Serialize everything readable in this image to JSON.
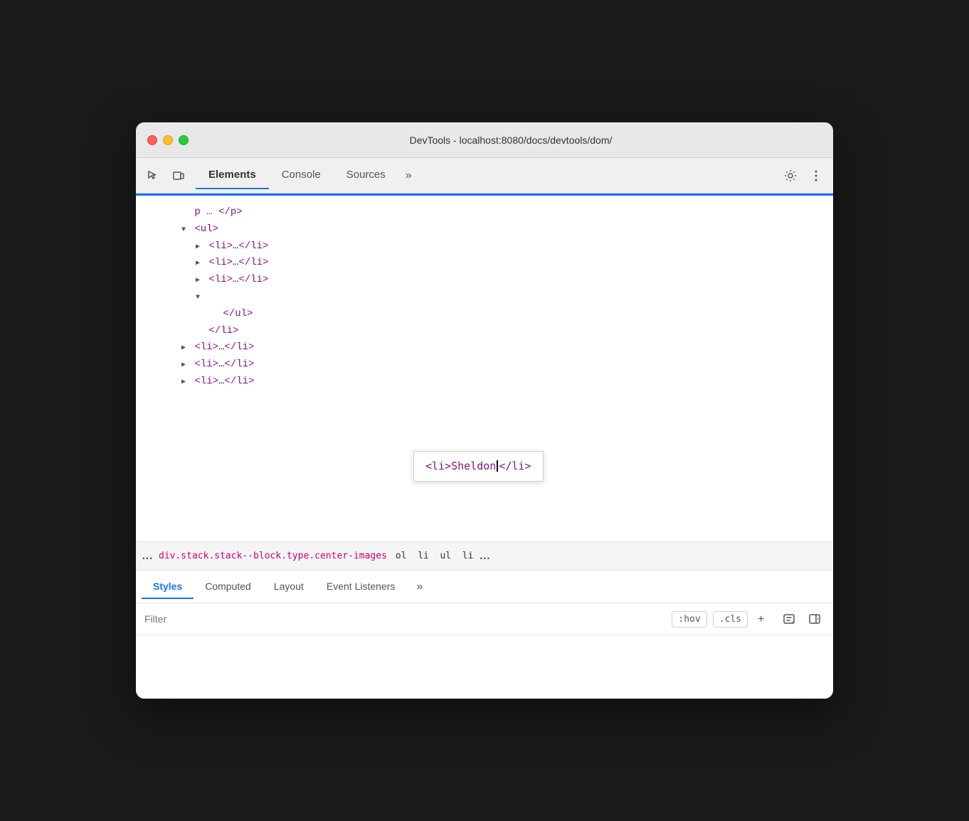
{
  "window": {
    "title": "DevTools - localhost:8080/docs/devtools/dom/"
  },
  "traffic_lights": {
    "close_label": "close",
    "minimize_label": "minimize",
    "maximize_label": "maximize"
  },
  "toolbar": {
    "inspect_icon": "⬚",
    "device_icon": "⬜",
    "tabs": [
      {
        "id": "elements",
        "label": "Elements",
        "active": true
      },
      {
        "id": "console",
        "label": "Console",
        "active": false
      },
      {
        "id": "sources",
        "label": "Sources",
        "active": false
      }
    ],
    "more_tabs_label": "»",
    "settings_icon": "⚙",
    "more_icon": "⋮"
  },
  "dom_tree": {
    "lines": [
      {
        "indent": 2,
        "triangle": "▼",
        "content": "<ul>"
      },
      {
        "indent": 3,
        "triangle": "▶",
        "content": "<li>…</li>"
      },
      {
        "indent": 3,
        "triangle": "▶",
        "content": "<li>…</li>"
      },
      {
        "indent": 3,
        "triangle": "▶",
        "content": "<li>…</li>"
      },
      {
        "indent": 3,
        "triangle": "▼",
        "content": "",
        "editor": true
      },
      {
        "indent": 4,
        "content": "</ul>"
      },
      {
        "indent": 3,
        "content": "</li>"
      },
      {
        "indent": 2,
        "triangle": "▶",
        "content": "<li>…</li>"
      },
      {
        "indent": 2,
        "triangle": "▶",
        "content": "<li>…</li>"
      },
      {
        "indent": 2,
        "triangle": "▶",
        "content": "<li>…</li>"
      }
    ],
    "top_content": "p … </p>",
    "editor_content": "<li>Sheldon</li>",
    "editor_cursor_pos": "after_Sheldon"
  },
  "breadcrumb": {
    "dots": "…",
    "path": "div.stack.stack--block.type.center-images",
    "items": [
      "ol",
      "li",
      "ul",
      "li"
    ],
    "more": "…"
  },
  "styles_panel": {
    "tabs": [
      {
        "id": "styles",
        "label": "Styles",
        "active": true
      },
      {
        "id": "computed",
        "label": "Computed",
        "active": false
      },
      {
        "id": "layout",
        "label": "Layout",
        "active": false
      },
      {
        "id": "event-listeners",
        "label": "Event Listeners",
        "active": false
      }
    ],
    "more_label": "»",
    "filter": {
      "placeholder": "Filter",
      "hov_label": ":hov",
      "cls_label": ".cls",
      "add_label": "+"
    }
  }
}
